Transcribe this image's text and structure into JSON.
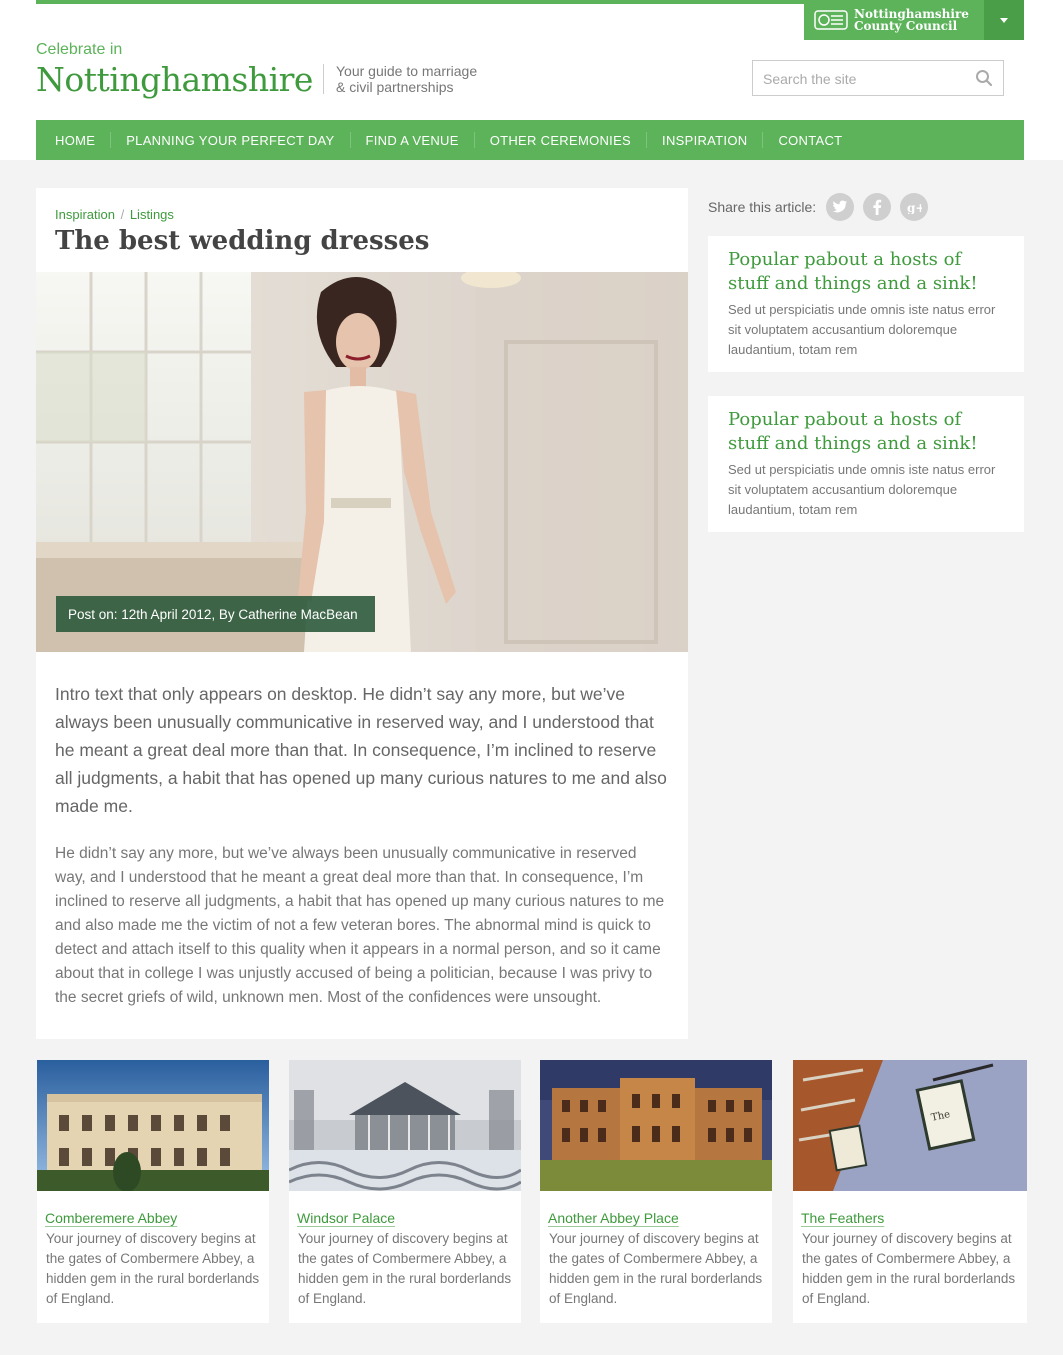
{
  "header": {
    "celebrate": "Celebrate in",
    "brand": "Nottinghamshire",
    "tagline_line1": "Your guide to marriage",
    "tagline_line2": "& civil partnerships",
    "council_line1": "Nottinghamshire",
    "council_line2": "County Council",
    "search_placeholder": "Search the site"
  },
  "nav": {
    "items": [
      {
        "label": "HOME"
      },
      {
        "label": "PLANNING YOUR PERFECT DAY"
      },
      {
        "label": "FIND A VENUE"
      },
      {
        "label": "OTHER CEREMONIES"
      },
      {
        "label": "INSPIRATION"
      },
      {
        "label": "CONTACT"
      }
    ]
  },
  "article": {
    "breadcrumb": [
      {
        "label": "Inspiration"
      },
      {
        "label": "Listings"
      }
    ],
    "title": "The best wedding dresses",
    "post_meta": "Post on: 12th April 2012, By Catherine MacBean",
    "intro": "Intro text that only appears on desktop. He didn’t say any more, but we’ve always been unusually communicative in reserved way, and I understood that he meant a great deal more than that. In consequence, I’m inclined to reserve all judgments, a habit that has opened up many curious natures to me and also made me.",
    "body": "He didn’t say any more, but we’ve always been unusually communicative in reserved way, and I understood that he meant a great deal more than that. In consequence, I’m inclined to reserve all judgments, a habit that has opened up many curious natures to me and also made me the victim of not a few veteran bores. The abnormal mind is quick to detect and attach itself to this quality when it appears in a normal person, and so it came about that in college I was unjustly accused of being a politician, because I was privy to the secret griefs of wild, unknown men. Most of the confidences were unsought."
  },
  "sidebar": {
    "share_label": "Share this article:",
    "share_icons": [
      "twitter-icon",
      "facebook-icon",
      "google-plus-icon"
    ],
    "promos": [
      {
        "title": "Popular pabout a hosts of stuff and things and a sink!",
        "text": "Sed ut perspiciatis unde omnis iste natus error sit voluptatem accusantium doloremque laudantium, totam rem"
      },
      {
        "title": "Popular pabout a hosts of stuff and things and a sink!",
        "text": "Sed ut perspiciatis unde omnis iste natus error sit voluptatem accusantium doloremque laudantium, totam rem"
      }
    ]
  },
  "venues": [
    {
      "name": "Comberemere Abbey",
      "desc": "Your journey of discovery begins at the gates of Combermere Abbey, a hidden gem in the rural borderlands of England."
    },
    {
      "name": "Windsor Palace",
      "desc": "Your journey of discovery begins at the gates of Combermere Abbey, a hidden gem in the rural borderlands of England."
    },
    {
      "name": "Another Abbey Place",
      "desc": "Your journey of discovery begins at the gates of Combermere Abbey, a hidden gem in the rural borderlands of England."
    },
    {
      "name": "The Feathers",
      "desc": "Your journey of discovery begins at the gates of Combermere Abbey, a hidden gem in the rural borderlands of England."
    }
  ],
  "colors": {
    "brand_green": "#5cb35a",
    "dark_green": "#3e9a3c",
    "background": "#f3f3f3"
  }
}
